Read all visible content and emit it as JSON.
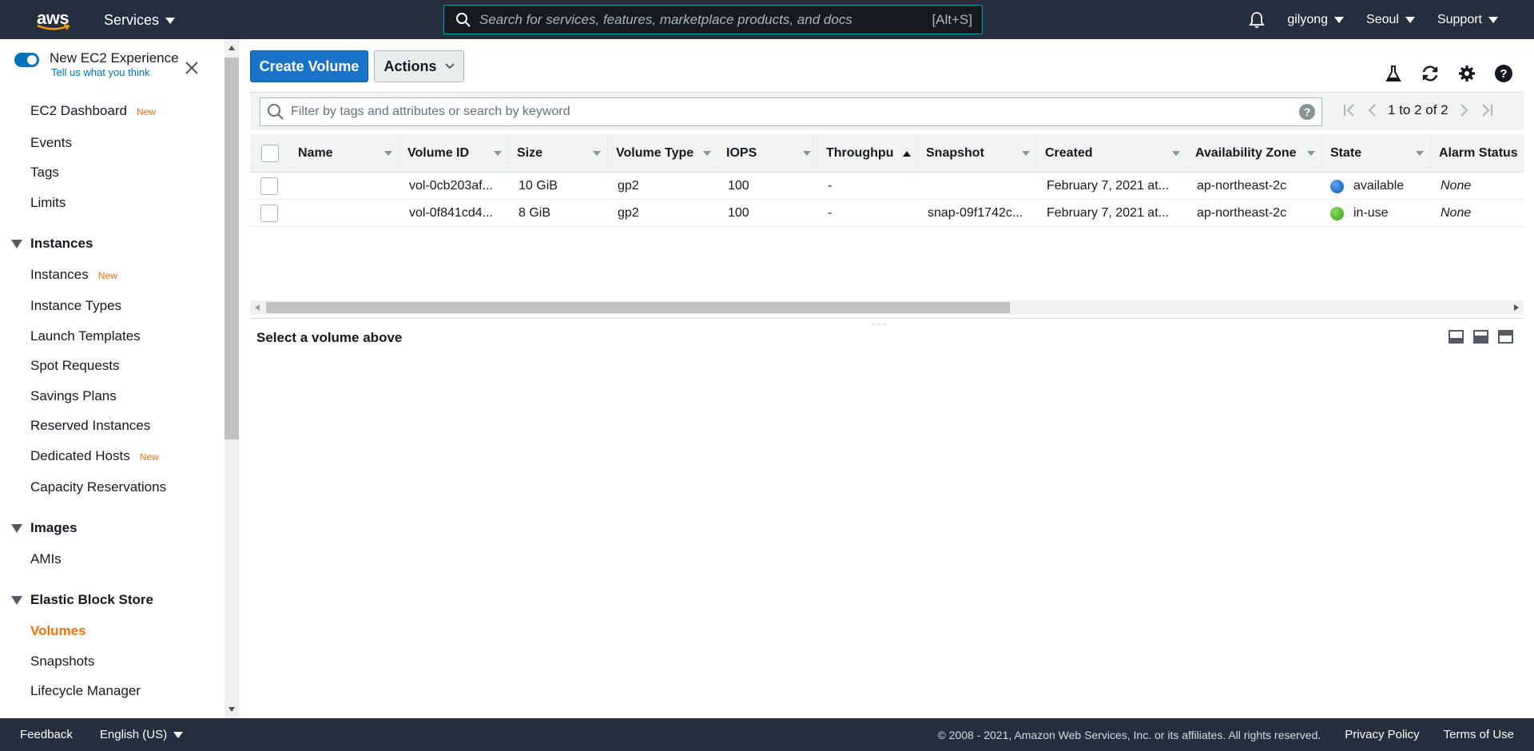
{
  "topnav": {
    "logo_text": "aws",
    "services_label": "Services",
    "search_placeholder": "Search for services, features, marketplace products, and docs",
    "search_hint": "[Alt+S]",
    "user": "gilyong",
    "region": "Seoul",
    "support": "Support"
  },
  "sidebar": {
    "experience_title": "New EC2 Experience",
    "experience_sub": "Tell us what you think",
    "new_badge": "New",
    "items": {
      "dashboard": "EC2 Dashboard",
      "events": "Events",
      "tags": "Tags",
      "limits": "Limits",
      "instances_head": "Instances",
      "instances": "Instances",
      "instance_types": "Instance Types",
      "launch_templates": "Launch Templates",
      "spot_requests": "Spot Requests",
      "savings_plans": "Savings Plans",
      "reserved_instances": "Reserved Instances",
      "dedicated_hosts": "Dedicated Hosts",
      "capacity_reservations": "Capacity Reservations",
      "images_head": "Images",
      "amis": "AMIs",
      "ebs_head": "Elastic Block Store",
      "volumes": "Volumes",
      "snapshots": "Snapshots",
      "lifecycle_manager": "Lifecycle Manager"
    }
  },
  "toolbar": {
    "create_label": "Create Volume",
    "actions_label": "Actions"
  },
  "filter": {
    "placeholder": "Filter by tags and attributes or search by keyword",
    "help": "?",
    "range": "1 to 2 of 2"
  },
  "table": {
    "headers": [
      "Name",
      "Volume ID",
      "Size",
      "Volume Type",
      "IOPS",
      "Throughpu",
      "Snapshot",
      "Created",
      "Availability Zone",
      "State",
      "Alarm Status"
    ],
    "rows": [
      {
        "name": "",
        "volume_id": "vol-0cb203af...",
        "size": "10 GiB",
        "type": "gp2",
        "iops": "100",
        "throughput": "-",
        "snapshot": "",
        "created": "February 7, 2021 at...",
        "az": "ap-northeast-2c",
        "state": "available",
        "alarm": "None"
      },
      {
        "name": "",
        "volume_id": "vol-0f841cd4...",
        "size": "8 GiB",
        "type": "gp2",
        "iops": "100",
        "throughput": "-",
        "snapshot": "snap-09f1742c...",
        "created": "February 7, 2021 at...",
        "az": "ap-northeast-2c",
        "state": "in-use",
        "alarm": "None"
      }
    ]
  },
  "detail": {
    "title": "Select a volume above"
  },
  "footer": {
    "feedback": "Feedback",
    "language": "English (US)",
    "copyright": "© 2008 - 2021, Amazon Web Services, Inc. or its affiliates. All rights reserved.",
    "privacy": "Privacy Policy",
    "terms": "Terms of Use"
  },
  "colors": {
    "nav_bg": "#232f3e",
    "accent_orange": "#ec7211",
    "primary_blue": "#1a73c8",
    "state_available": "#1a6fd1",
    "state_in_use": "#3cb323"
  }
}
